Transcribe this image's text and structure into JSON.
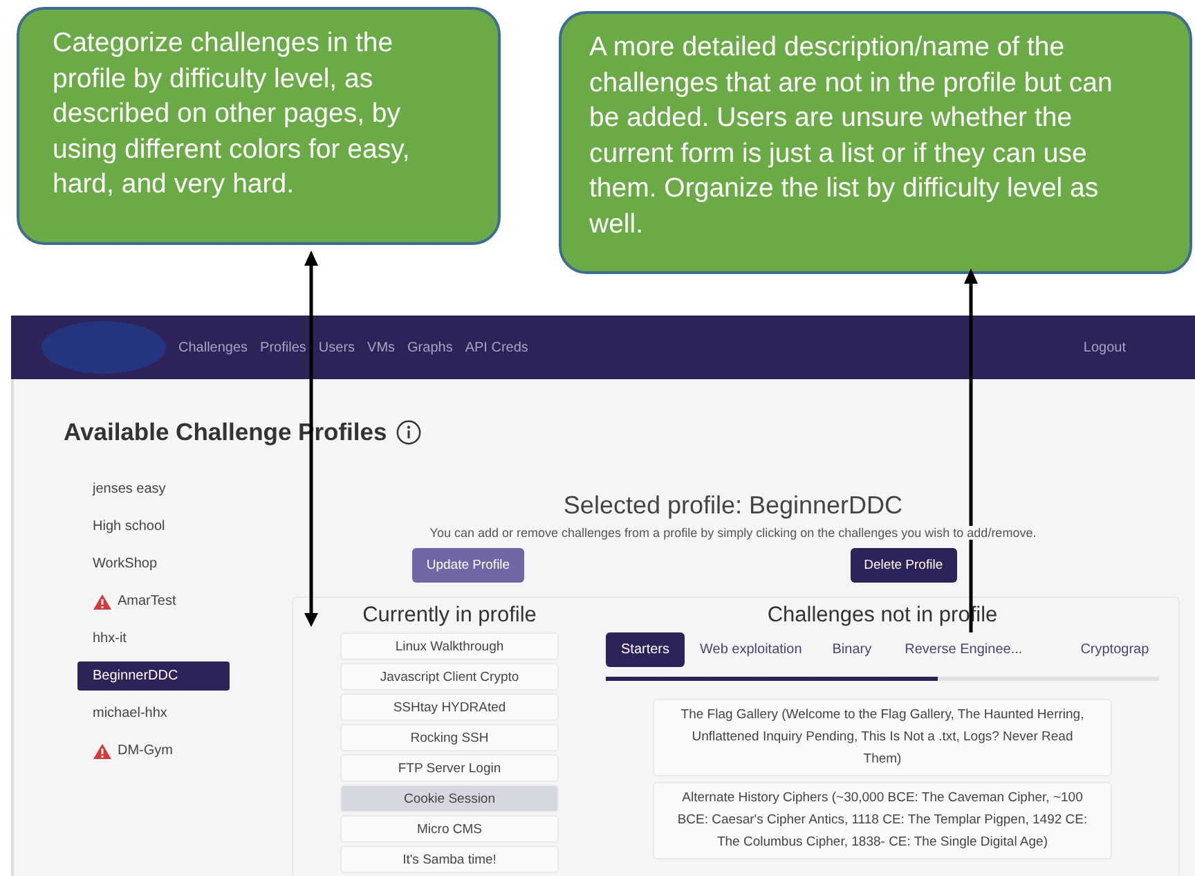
{
  "callouts": [
    {
      "text": "Categorize challenges in the profile by difficulty level, as described on other pages, by using different colors for easy, hard, and very hard."
    },
    {
      "text": "A more detailed description/name of the challenges that are not in the profile but can be added. Users are unsure whether the current form is just a list or if they can use them. Organize the list by difficulty level as well."
    }
  ],
  "navbar": {
    "links": [
      "Challenges",
      "Profiles",
      "Users",
      "VMs",
      "Graphs",
      "API Creds"
    ],
    "logout": "Logout"
  },
  "page_title": "Available Challenge Profiles",
  "profiles": [
    {
      "name": "jenses easy",
      "selected": false,
      "warning": false
    },
    {
      "name": "High school",
      "selected": false,
      "warning": false
    },
    {
      "name": "WorkShop",
      "selected": false,
      "warning": false
    },
    {
      "name": "AmarTest",
      "selected": false,
      "warning": true
    },
    {
      "name": "hhx-it",
      "selected": false,
      "warning": false
    },
    {
      "name": "BeginnerDDC",
      "selected": true,
      "warning": false
    },
    {
      "name": "michael-hhx",
      "selected": false,
      "warning": false
    },
    {
      "name": "DM-Gym",
      "selected": false,
      "warning": true
    }
  ],
  "selected_profile": {
    "heading": "Selected profile: BeginnerDDC",
    "hint": "You can add or remove challenges from a profile by simply clicking on the challenges you wish to add/remove.",
    "update_button": "Update Profile",
    "delete_button": "Delete Profile"
  },
  "in_profile": {
    "heading": "Currently in profile",
    "items": [
      {
        "name": "Linux Walkthrough",
        "highlighted": false
      },
      {
        "name": "Javascript Client Crypto",
        "highlighted": false
      },
      {
        "name": "SSHtay HYDRAted",
        "highlighted": false
      },
      {
        "name": "Rocking SSH",
        "highlighted": false
      },
      {
        "name": "FTP Server Login",
        "highlighted": false
      },
      {
        "name": "Cookie Session",
        "highlighted": true
      },
      {
        "name": "Micro CMS",
        "highlighted": false
      },
      {
        "name": "It's Samba time!",
        "highlighted": false
      }
    ]
  },
  "not_in_profile": {
    "heading": "Challenges not in profile",
    "tabs": [
      {
        "label": "Starters",
        "selected": true
      },
      {
        "label": "Web exploitation",
        "selected": false
      },
      {
        "label": "Binary",
        "selected": false
      },
      {
        "label": "Reverse Enginee...",
        "selected": false
      },
      {
        "label": "Cryptograp",
        "selected": false
      }
    ],
    "items": [
      "The Flag Gallery (Welcome to the Flag Gallery, The Haunted Herring, Unflattened Inquiry Pending, This Is Not a .txt, Logs? Never Read Them)",
      "Alternate History Ciphers (~30,000 BCE: The Caveman Cipher, ~100 BCE: Caesar's Cipher Antics, 1118 CE: The Templar Pigpen, 1492 CE: The Columbus Cipher, 1838- CE: The Single Digital Age)"
    ]
  }
}
